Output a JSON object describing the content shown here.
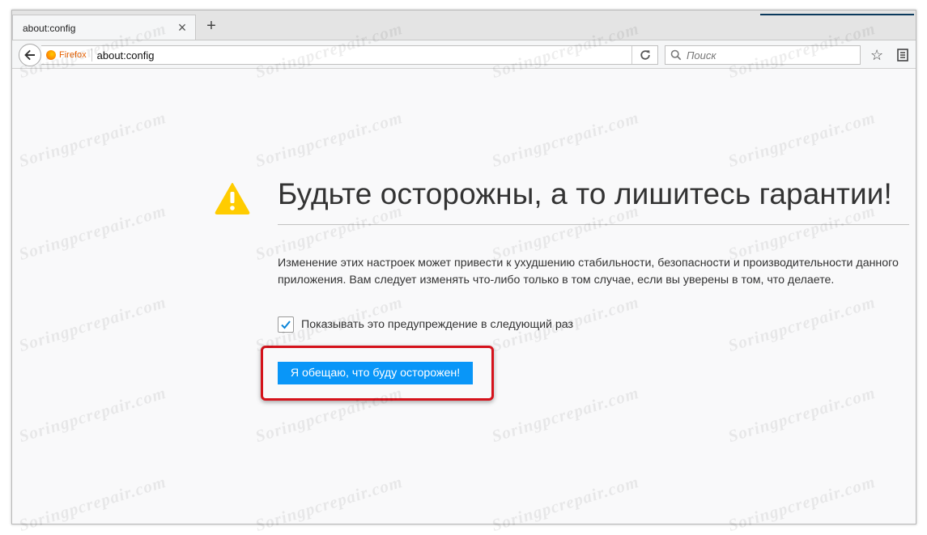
{
  "tab": {
    "title": "about:config",
    "close_glyph": "×"
  },
  "toolbar": {
    "new_tab_glyph": "+",
    "identity_label": "Firefox",
    "url": "about:config",
    "search_placeholder": "Поиск"
  },
  "page": {
    "title": "Будьте осторожны, а то лишитесь гарантии!",
    "description": "Изменение этих настроек может привести к ухудшению стабильности, безопасности и производительности данного приложения. Вам следует изменять что-либо только в том случае, если вы уверены в том, что делаете.",
    "checkbox_label": "Показывать это предупреждение в следующий раз",
    "checkbox_checked": true,
    "button_label": "Я обещаю, что буду осторожен!"
  },
  "watermark": "Soringpcrepair.com",
  "colors": {
    "accent_button": "#0996f8",
    "warning_icon": "#ffcc00",
    "highlight_border": "#d5121b",
    "firefox_label": "#e66000"
  },
  "icons": [
    "back-arrow-icon",
    "firefox-icon",
    "reload-icon",
    "search-icon",
    "star-icon",
    "reader-list-icon",
    "warning-icon",
    "checkmark-icon",
    "close-icon",
    "plus-icon"
  ]
}
